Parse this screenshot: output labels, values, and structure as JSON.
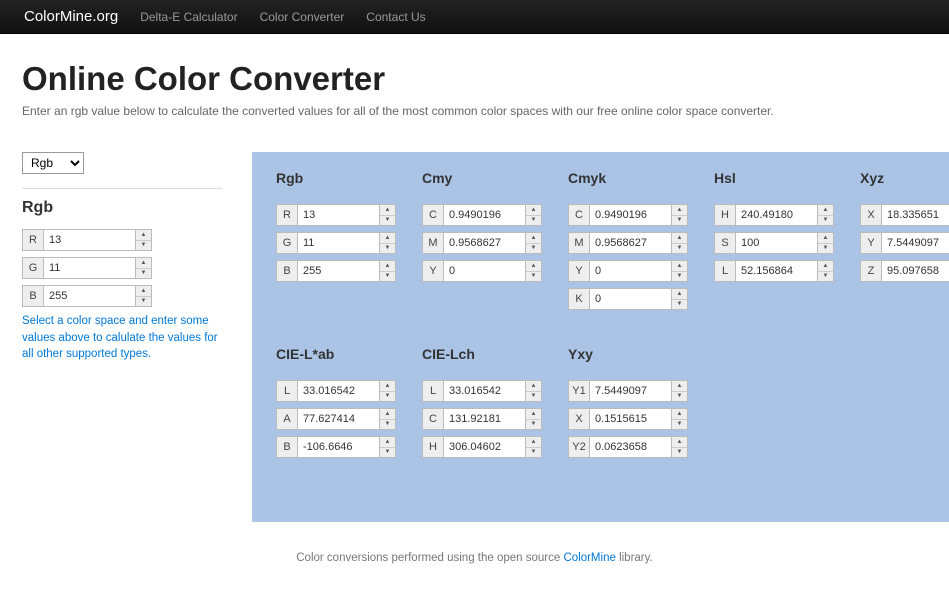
{
  "nav": {
    "brand": "ColorMine.org",
    "links": [
      "Delta-E Calculator",
      "Color Converter",
      "Contact Us"
    ]
  },
  "page": {
    "title": "Online Color Converter",
    "subtitle": "Enter an rgb value below to calculate the converted values for all of the most common color spaces with our free online color space converter."
  },
  "sidebar": {
    "selected_space": "Rgb",
    "heading": "Rgb",
    "fields": [
      {
        "label": "R",
        "value": "13"
      },
      {
        "label": "G",
        "value": "11"
      },
      {
        "label": "B",
        "value": "255"
      }
    ],
    "help": "Select a color space and enter some values above to calulate the values for all other supported types."
  },
  "spaces_row1": [
    {
      "name": "Rgb",
      "fields": [
        {
          "label": "R",
          "value": "13"
        },
        {
          "label": "G",
          "value": "11"
        },
        {
          "label": "B",
          "value": "255"
        }
      ]
    },
    {
      "name": "Cmy",
      "fields": [
        {
          "label": "C",
          "value": "0.9490196"
        },
        {
          "label": "M",
          "value": "0.9568627"
        },
        {
          "label": "Y",
          "value": "0"
        }
      ]
    },
    {
      "name": "Cmyk",
      "fields": [
        {
          "label": "C",
          "value": "0.9490196"
        },
        {
          "label": "M",
          "value": "0.9568627"
        },
        {
          "label": "Y",
          "value": "0"
        },
        {
          "label": "K",
          "value": "0"
        }
      ]
    },
    {
      "name": "Hsl",
      "fields": [
        {
          "label": "H",
          "value": "240.49180"
        },
        {
          "label": "S",
          "value": "100"
        },
        {
          "label": "L",
          "value": "52.156864"
        }
      ]
    },
    {
      "name": "Xyz",
      "fields": [
        {
          "label": "X",
          "value": "18.335651"
        },
        {
          "label": "Y",
          "value": "7.5449097"
        },
        {
          "label": "Z",
          "value": "95.097658"
        }
      ]
    }
  ],
  "spaces_row2": [
    {
      "name": "CIE-L*ab",
      "fields": [
        {
          "label": "L",
          "value": "33.016542"
        },
        {
          "label": "A",
          "value": "77.627414"
        },
        {
          "label": "B",
          "value": "-106.6646"
        }
      ]
    },
    {
      "name": "CIE-Lch",
      "fields": [
        {
          "label": "L",
          "value": "33.016542"
        },
        {
          "label": "C",
          "value": "131.92181"
        },
        {
          "label": "H",
          "value": "306.04602"
        }
      ]
    },
    {
      "name": "Yxy",
      "fields": [
        {
          "label": "Y1",
          "value": "7.5449097"
        },
        {
          "label": "X",
          "value": "0.1515615"
        },
        {
          "label": "Y2",
          "value": "0.0623658"
        }
      ]
    }
  ],
  "footer": {
    "text_before": "Color conversions performed using the open source ",
    "link_text": "ColorMine",
    "text_after": " library."
  }
}
